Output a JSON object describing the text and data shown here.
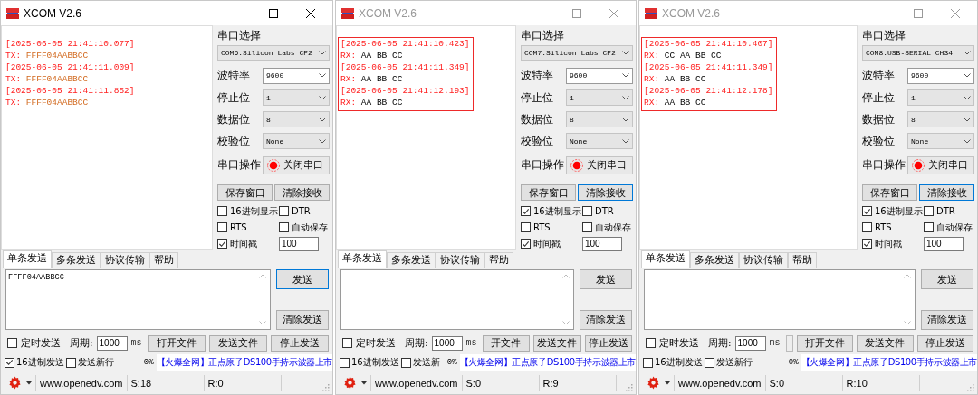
{
  "windows": [
    {
      "title": "XCOM V2.6",
      "active": true,
      "log": {
        "highlighted": false,
        "lines": [
          {
            "kind": "stamp",
            "text": "[2025-06-05 21:41:10.077]"
          },
          {
            "kind": "tx",
            "prefix": "TX:",
            "text": "FFFF04AABBCC"
          },
          {
            "kind": "stamp",
            "text": "[2025-06-05 21:41:11.009]"
          },
          {
            "kind": "tx",
            "prefix": "TX:",
            "text": "FFFF04AABBCC"
          },
          {
            "kind": "stamp",
            "text": "[2025-06-05 21:41:11.852]"
          },
          {
            "kind": "tx",
            "prefix": "TX:",
            "text": "FFFF04AABBCC"
          }
        ]
      },
      "port": {
        "label": "串口选择",
        "value": "COM6:Silicon Labs CP2"
      },
      "settings": [
        {
          "label": "波特率",
          "value": "9600",
          "editable": true
        },
        {
          "label": "停止位",
          "value": "1",
          "editable": false
        },
        {
          "label": "数据位",
          "value": "8",
          "editable": false
        },
        {
          "label": "校验位",
          "value": "None",
          "editable": false
        }
      ],
      "operation": {
        "label": "串口操作",
        "button": "关闭串口",
        "open": true
      },
      "buttons": [
        {
          "label": "保存窗口",
          "focused": false
        },
        {
          "label": "清除接收",
          "focused": false
        }
      ],
      "options": [
        {
          "label": "16进制显示",
          "checked": false
        },
        {
          "label": "DTR",
          "checked": false
        },
        {
          "label": "RTS",
          "checked": false
        },
        {
          "label": "自动保存",
          "checked": false
        }
      ],
      "timestamp": {
        "label": "时间戳",
        "checked": true,
        "value": "100"
      },
      "tabs": [
        {
          "label": "单条发送",
          "selected": true
        },
        {
          "label": "多条发送",
          "selected": false
        },
        {
          "label": "协议传输",
          "selected": false
        },
        {
          "label": "帮助",
          "selected": false
        }
      ],
      "send": {
        "value": "FFFF04AABBCC"
      },
      "send_buttons": [
        {
          "label": "发送",
          "focused": true
        },
        {
          "label": "清除发送",
          "focused": false
        }
      ],
      "timer": {
        "label": "定时发送",
        "checked": false
      },
      "period": {
        "label": "周期:",
        "value": "1000",
        "unit": "ms"
      },
      "indicator": false,
      "file_buttons": [
        {
          "label": "打开文件"
        },
        {
          "label": "发送文件"
        },
        {
          "label": "停止发送"
        }
      ],
      "hex_send": {
        "label": "16进制发送",
        "checked": true
      },
      "newline": {
        "label": "发送新行",
        "checked": false
      },
      "percent": "0%",
      "ad": "【火爆全网】正点原子DS100手持示波器上市",
      "status": {
        "site": "www.openedv.com",
        "sent": "S:18",
        "received": "R:0"
      }
    },
    {
      "title": "XCOM V2.6",
      "active": false,
      "log": {
        "highlighted": true,
        "lines": [
          {
            "kind": "stamp",
            "text": "[2025-06-05 21:41:10.423]"
          },
          {
            "kind": "rx",
            "prefix": "RX:",
            "text": "AA BB CC"
          },
          {
            "kind": "stamp",
            "text": "[2025-06-05 21:41:11.349]"
          },
          {
            "kind": "rx",
            "prefix": "RX:",
            "text": "AA BB CC"
          },
          {
            "kind": "stamp",
            "text": "[2025-06-05 21:41:12.193]"
          },
          {
            "kind": "rx",
            "prefix": "RX:",
            "text": "AA BB CC"
          }
        ]
      },
      "port": {
        "label": "串口选择",
        "value": "COM7:Silicon Labs CP2"
      },
      "settings": [
        {
          "label": "波特率",
          "value": "9600",
          "editable": true
        },
        {
          "label": "停止位",
          "value": "1",
          "editable": false
        },
        {
          "label": "数据位",
          "value": "8",
          "editable": false
        },
        {
          "label": "校验位",
          "value": "None",
          "editable": false
        }
      ],
      "operation": {
        "label": "串口操作",
        "button": "关闭串口",
        "open": true
      },
      "buttons": [
        {
          "label": "保存窗口",
          "focused": false
        },
        {
          "label": "清除接收",
          "focused": true
        }
      ],
      "options": [
        {
          "label": "16进制显示",
          "checked": true
        },
        {
          "label": "DTR",
          "checked": false
        },
        {
          "label": "RTS",
          "checked": false
        },
        {
          "label": "自动保存",
          "checked": false
        }
      ],
      "timestamp": {
        "label": "时间戳",
        "checked": true,
        "value": "100"
      },
      "tabs": [
        {
          "label": "单条发送",
          "selected": true
        },
        {
          "label": "多条发送",
          "selected": false
        },
        {
          "label": "协议传输",
          "selected": false
        },
        {
          "label": "帮助",
          "selected": false
        }
      ],
      "send_buttons": [
        {
          "label": "发送",
          "focused": false
        },
        {
          "label": "清除发送",
          "focused": false
        }
      ],
      "timer": {
        "label": "定时发送",
        "checked": false
      },
      "period": {
        "label": "周期:",
        "value": "1000",
        "unit": "ms"
      },
      "indicator": false,
      "file_buttons": [
        {
          "label": "开文件"
        },
        {
          "label": "发送文件"
        },
        {
          "label": "停止发送"
        }
      ],
      "hex_send": {
        "label": "16进制发送",
        "checked": false
      },
      "newline": {
        "label": "发送新",
        "checked": false
      },
      "percent": "0%",
      "ad": "【火爆全网】正点原子DS100手持示波器上市",
      "status": {
        "site": "www.openedv.com",
        "sent": "S:0",
        "received": "R:9"
      }
    },
    {
      "title": "XCOM V2.6",
      "active": false,
      "log": {
        "highlighted": true,
        "lines": [
          {
            "kind": "stamp",
            "text": "[2025-06-05 21:41:10.407]"
          },
          {
            "kind": "rx",
            "prefix": "RX:",
            "text": "CC AA BB CC"
          },
          {
            "kind": "stamp",
            "text": "[2025-06-05 21:41:11.349]"
          },
          {
            "kind": "rx",
            "prefix": "RX:",
            "text": "AA BB CC"
          },
          {
            "kind": "stamp",
            "text": "[2025-06-05 21:41:12.178]"
          },
          {
            "kind": "rx",
            "prefix": "RX:",
            "text": "AA BB CC"
          }
        ]
      },
      "port": {
        "label": "串口选择",
        "value": "COM8:USB-SERIAL CH34"
      },
      "settings": [
        {
          "label": "波特率",
          "value": "9600",
          "editable": true
        },
        {
          "label": "停止位",
          "value": "1",
          "editable": false
        },
        {
          "label": "数据位",
          "value": "8",
          "editable": false
        },
        {
          "label": "校验位",
          "value": "None",
          "editable": false
        }
      ],
      "operation": {
        "label": "串口操作",
        "button": "关闭串口",
        "open": true
      },
      "buttons": [
        {
          "label": "保存窗口",
          "focused": false
        },
        {
          "label": "清除接收",
          "focused": true
        }
      ],
      "options": [
        {
          "label": "16进制显示",
          "checked": true
        },
        {
          "label": "DTR",
          "checked": false
        },
        {
          "label": "RTS",
          "checked": false
        },
        {
          "label": "自动保存",
          "checked": false
        }
      ],
      "timestamp": {
        "label": "时间戳",
        "checked": true,
        "value": "100"
      },
      "tabs": [
        {
          "label": "单条发送",
          "selected": true
        },
        {
          "label": "多条发送",
          "selected": false
        },
        {
          "label": "协议传输",
          "selected": false
        },
        {
          "label": "帮助",
          "selected": false
        }
      ],
      "send_buttons": [
        {
          "label": "发送",
          "focused": false
        },
        {
          "label": "清除发送",
          "focused": false
        }
      ],
      "timer": {
        "label": "定时发送",
        "checked": false
      },
      "period": {
        "label": "周期:",
        "value": "1000",
        "unit": "ms"
      },
      "indicator": true,
      "file_buttons": [
        {
          "label": "打开文件"
        },
        {
          "label": "发送文件"
        },
        {
          "label": "停止发送"
        }
      ],
      "hex_send": {
        "label": "16进制发送",
        "checked": false
      },
      "newline": {
        "label": "发送新行",
        "checked": false
      },
      "percent": "0%",
      "ad": "【火爆全网】正点原子DS100手持示波器上市",
      "status": {
        "site": "www.openedv.com",
        "sent": "S:0",
        "received": "R:10"
      }
    }
  ]
}
